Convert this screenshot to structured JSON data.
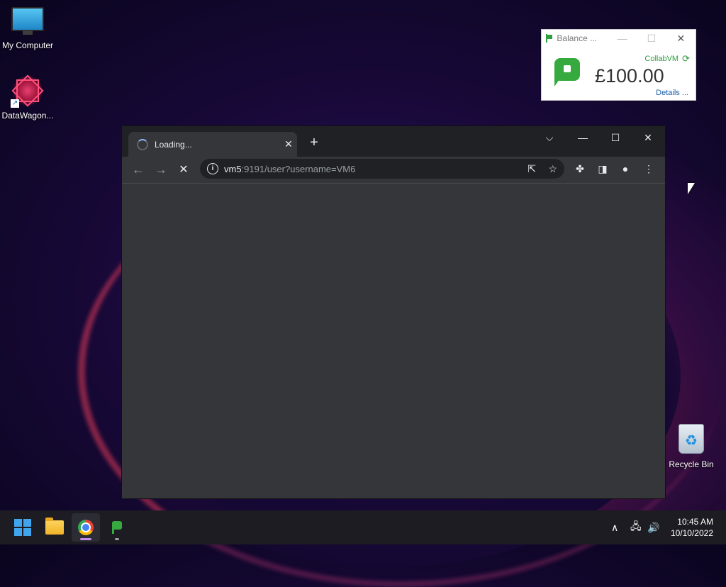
{
  "desktop": {
    "icons": [
      {
        "label": "My Computer",
        "icon": "monitor-icon"
      },
      {
        "label": "DataWagon...",
        "icon": "datawagon-icon"
      },
      {
        "label": "Recycle Bin",
        "icon": "recycle-bin-icon"
      }
    ]
  },
  "widget": {
    "title": "Balance ...",
    "minimize": "—",
    "maximize": "☐",
    "close": "✕",
    "source": "CollabVM",
    "refresh_icon": "⟳",
    "amount": "£100.00",
    "details": "Details ..."
  },
  "browser": {
    "tab_title": "Loading...",
    "tab_close": "✕",
    "new_tab": "+",
    "tab_search": "⌵",
    "window_minimize": "—",
    "window_maximize": "☐",
    "window_close": "✕",
    "back": "←",
    "forward": "→",
    "stop": "✕",
    "url_host": "vm5",
    "url_path": ":9191/user?username=VM6",
    "info": "i",
    "share": "⇱",
    "bookmark": "☆",
    "extensions": "✤",
    "side_panel": "◨",
    "profile": "●",
    "menu": "⋮"
  },
  "taskbar": {
    "tray_chevron": "∧",
    "network": "🖧",
    "volume": "🔊",
    "time": "10:45 AM",
    "date": "10/10/2022"
  },
  "colors": {
    "accent_green": "#36a93f",
    "chrome_dark": "#202124",
    "chrome_mid": "#35363a"
  }
}
